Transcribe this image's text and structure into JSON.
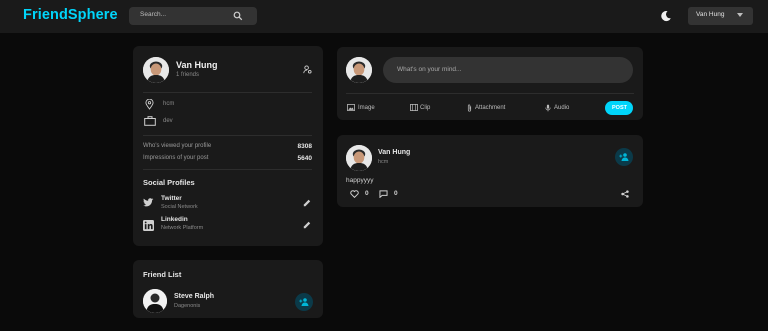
{
  "app": {
    "logo": "FriendSphere"
  },
  "search": {
    "placeholder": "Search..."
  },
  "user_menu": {
    "name": "Van Hung"
  },
  "profile": {
    "name": "Van Hung",
    "friends": "1 friends",
    "location": "hcm",
    "occupation": "dev",
    "stats": [
      {
        "label": "Who's viewed your profile",
        "value": "8308"
      },
      {
        "label": "Impressions of your post",
        "value": "5640"
      }
    ],
    "social_title": "Social Profiles",
    "socials": [
      {
        "name": "Twitter",
        "type": "Social Network"
      },
      {
        "name": "Linkedin",
        "type": "Network Platform"
      }
    ]
  },
  "friend_list": {
    "title": "Friend List",
    "friends": [
      {
        "name": "Steve Ralph",
        "location": "Dagenonis"
      }
    ]
  },
  "composer": {
    "placeholder": "What's on your mind...",
    "actions": [
      "Image",
      "Clip",
      "Attachment",
      "Audio"
    ],
    "post_label": "POST"
  },
  "post": {
    "author": "Van Hung",
    "location": "hcm",
    "text": "happyyyy",
    "likes": "0",
    "comments": "0"
  },
  "colors": {
    "accent": "#00d5fa",
    "card": "#1a1a1a",
    "background": "#0a0a0a"
  }
}
